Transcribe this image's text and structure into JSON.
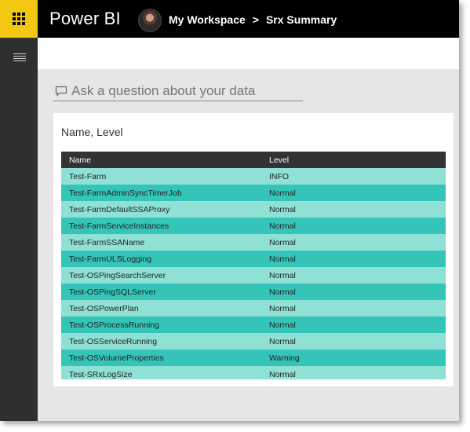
{
  "header": {
    "app_name": "Power BI",
    "breadcrumb": [
      {
        "label": "My Workspace"
      },
      {
        "label": "Srx Summary"
      }
    ],
    "separator": ">",
    "launcher_color": "#f2c811"
  },
  "qna": {
    "placeholder": "Ask a question about your data"
  },
  "card": {
    "title": "Name, Level",
    "columns": [
      "Name",
      "Level"
    ],
    "rows": [
      {
        "name": "Test-Farm",
        "level": "INFO"
      },
      {
        "name": "Test-FarmAdminSyncTimerJob",
        "level": "Normal"
      },
      {
        "name": "Test-FarmDefaultSSAProxy",
        "level": "Normal"
      },
      {
        "name": "Test-FarmServiceInstances",
        "level": "Normal"
      },
      {
        "name": "Test-FarmSSAName",
        "level": "Normal"
      },
      {
        "name": "Test-FarmULSLogging",
        "level": "Normal"
      },
      {
        "name": "Test-OSPingSearchServer",
        "level": "Normal"
      },
      {
        "name": "Test-OSPingSQLServer",
        "level": "Normal"
      },
      {
        "name": "Test-OSPowerPlan",
        "level": "Normal"
      },
      {
        "name": "Test-OSProcessRunning",
        "level": "Normal"
      },
      {
        "name": "Test-OSServiceRunning",
        "level": "Normal"
      },
      {
        "name": "Test-OSVolumeProperties",
        "level": "Warning"
      },
      {
        "name": "Test-SRxLogSize",
        "level": "Normal"
      }
    ],
    "row_colors": [
      "#8fe1d6",
      "#35c4b8"
    ]
  },
  "icons": {
    "launcher": "app-launcher-waffle-icon",
    "nav": "hamburger-menu-icon",
    "qna": "speech-bubble-icon",
    "avatar": "user-avatar"
  }
}
